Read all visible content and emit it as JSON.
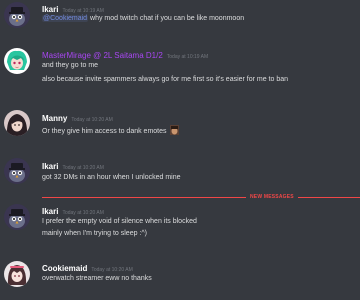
{
  "colors": {
    "background": "#36393f",
    "text": "#dcddde",
    "author_default": "#ffffff",
    "author_special": "#a846f2",
    "timestamp": "#72767d",
    "mention": "#7289da",
    "new_messages": "#f04747"
  },
  "messages": [
    {
      "author": "Ikari",
      "timestamp": "Today at 10:19 AM",
      "mention": "@Cookiemaid",
      "lines": [
        "why mod twitch chat if you can be like moonmoon"
      ],
      "avatar_icon": "hat-bird-avatar"
    },
    {
      "author": "MasterMirage @ 2L Saitama D1/2",
      "timestamp": "Today at 10:19 AM",
      "lines": [
        "and they go to me",
        "also because invite spammers always go for me first so it's easier for me to ban"
      ],
      "emote_icon": "crescent-emote-icon",
      "avatar_icon": "green-hair-anime-avatar"
    },
    {
      "author": "Manny",
      "timestamp": "Today at 10:20 AM",
      "lines": [
        "Or they give him access to dank emotes"
      ],
      "emote_icon": "face-emote-icon",
      "avatar_icon": "dark-hair-avatar"
    },
    {
      "author": "Ikari",
      "timestamp": "Today at 10:20 AM",
      "lines": [
        "got 32 DMs in an hour when I unlocked mine"
      ],
      "avatar_icon": "hat-bird-avatar"
    },
    {
      "author": "Ikari",
      "timestamp": "Today at 10:20 AM",
      "lines": [
        "I prefer the empty void of silence when its blocked",
        "mainly when I'm trying to sleep :^)"
      ],
      "avatar_icon": "hat-bird-avatar"
    },
    {
      "author": "Cookiemaid",
      "timestamp": "Today at 10:20 AM",
      "lines": [
        "overwatch streamer eww no thanks"
      ],
      "avatar_icon": "anime-girl-avatar"
    }
  ],
  "divider": {
    "label": "NEW MESSAGES"
  }
}
